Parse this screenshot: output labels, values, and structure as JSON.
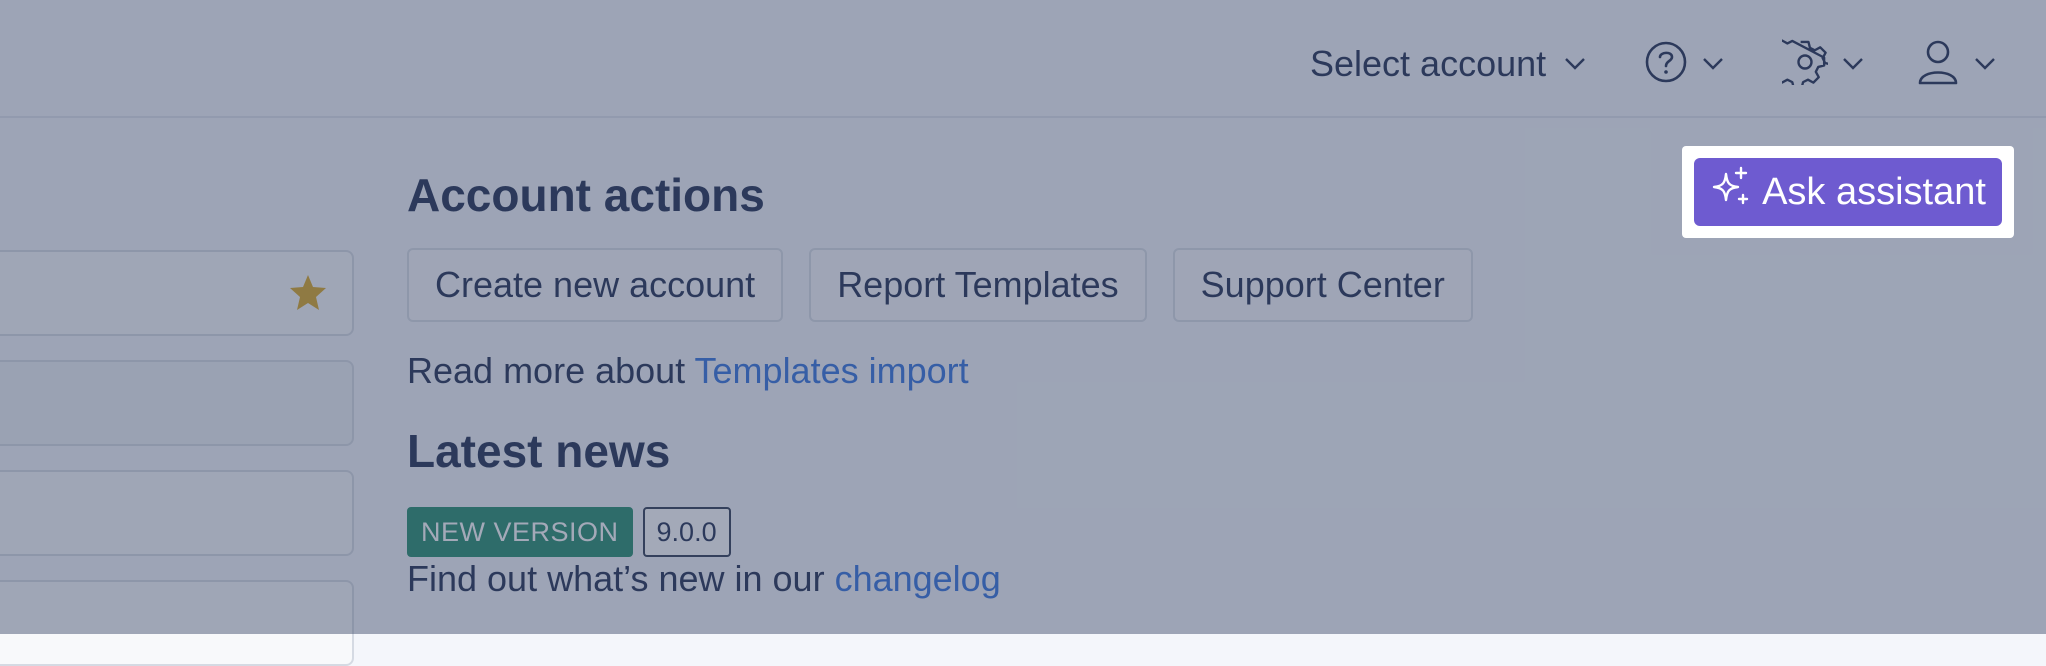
{
  "header": {
    "account_select_label": "Select account",
    "icons": [
      "help-circle-icon",
      "gear-icon",
      "user-icon",
      "chevron-down-icon"
    ]
  },
  "sidebar": {
    "favorite_icon": "star-icon",
    "favorite_color": "#7a6218"
  },
  "main": {
    "account_actions_title": "Account actions",
    "buttons": [
      {
        "label": "Create new account"
      },
      {
        "label": "Report Templates"
      },
      {
        "label": "Support Center"
      }
    ],
    "read_more_prefix": "Read more about ",
    "read_more_link": "Templates import",
    "latest_news_title": "Latest news",
    "new_version_badge": "NEW VERSION",
    "version_badge": "9.0.0",
    "changelog_prefix": "Find out what’s new in our ",
    "changelog_link": "changelog"
  },
  "assistant": {
    "label": "Ask assistant",
    "icon": "sparkles-icon",
    "color": "#6e5bd0"
  },
  "colors": {
    "link": "#2f6fdc",
    "badge_green": "#1f8a6a",
    "text": "#1b2a4e"
  }
}
